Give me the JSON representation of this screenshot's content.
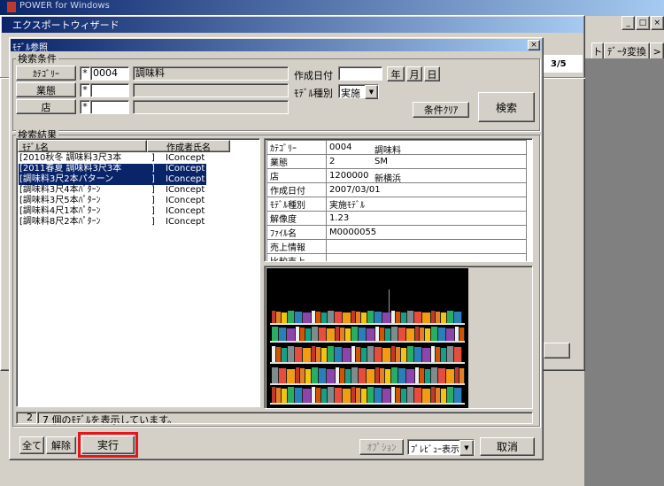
{
  "bg_app": {
    "title": "POWER for Windows",
    "tabs": [
      "ト",
      "ﾃﾞｰﾀ変換",
      ">"
    ],
    "page_counter": "3/5",
    "window_controls": [
      "_",
      "□",
      "×"
    ]
  },
  "wizard": {
    "title": "エクスポートウィザード"
  },
  "dialog": {
    "title": "ﾓﾃﾞﾙ参照",
    "close": "×",
    "search_conditions": {
      "group_label": "検索条件",
      "category": {
        "label": "ｶﾃｺﾞﾘｰ",
        "star": "*",
        "code": "0004",
        "name": "調味料"
      },
      "business": {
        "label": "業態",
        "star": "*",
        "code": "",
        "name": ""
      },
      "store": {
        "label": "店",
        "star": "*",
        "code": "",
        "name": ""
      },
      "created_date": {
        "label": "作成日付",
        "value": "",
        "year": "年",
        "month": "月",
        "day": "日"
      },
      "model_type": {
        "label": "ﾓﾃﾞﾙ種別",
        "value": "実施"
      },
      "clear_button": "条件ｸﾘｱ",
      "search_button": "検索"
    },
    "results": {
      "group_label": "検索結果",
      "columns": [
        "ﾓﾃﾞﾙ名",
        "作成者氏名"
      ],
      "rows": [
        {
          "name": "[2010秋冬 調味料3尺3本",
          "bracket": "]",
          "author": "IConcept",
          "selected": false
        },
        {
          "name": "[2011春夏 調味料3尺3本",
          "bracket": "]",
          "author": "IConcept",
          "selected": true
        },
        {
          "name": "[調味料3尺2本パターン",
          "bracket": "]",
          "author": "IConcept",
          "selected": true
        },
        {
          "name": "[調味料3尺4本ﾊﾟﾀｰﾝ",
          "bracket": "]",
          "author": "IConcept",
          "selected": false
        },
        {
          "name": "[調味料3尺5本ﾊﾟﾀｰﾝ",
          "bracket": "]",
          "author": "IConcept",
          "selected": false
        },
        {
          "name": "[調味料4尺1本ﾊﾟﾀｰﾝ",
          "bracket": "]",
          "author": "IConcept",
          "selected": false
        },
        {
          "name": "[調味料8尺2本ﾊﾟﾀｰﾝ",
          "bracket": "]",
          "author": "IConcept",
          "selected": false
        }
      ],
      "status_count": "2",
      "status_text": "7 個のﾓﾃﾞﾙを表示しています。"
    },
    "detail": [
      {
        "key": "ｶﾃｺﾞﾘｰ",
        "v1": "0004",
        "v2": "調味料"
      },
      {
        "key": "業態",
        "v1": "2",
        "v2": "SM"
      },
      {
        "key": "店",
        "v1": "1200000",
        "v2": "新横浜"
      },
      {
        "key": "作成日付",
        "v1": "2007/03/01",
        "v2": ""
      },
      {
        "key": "ﾓﾃﾞﾙ種別",
        "v1": "実施ﾓﾃﾞﾙ",
        "v2": ""
      },
      {
        "key": "解像度",
        "v1": "1.23",
        "v2": ""
      },
      {
        "key": "ﾌｧｲﾙ名",
        "v1": "M0000055",
        "v2": ""
      },
      {
        "key": "売上情報",
        "v1": "",
        "v2": ""
      },
      {
        "key": "比較売上",
        "v1": "",
        "v2": ""
      }
    ],
    "footer": {
      "all_button": "全て",
      "clear_button": "解除",
      "run_button": "実行",
      "option_button": "ｵﾌﾟｼｮﾝ",
      "preview_select": "ﾌﾟﾚﾋﾞｭｰ表示",
      "cancel_button": "取消"
    },
    "highlight_color": "#e8141b"
  }
}
